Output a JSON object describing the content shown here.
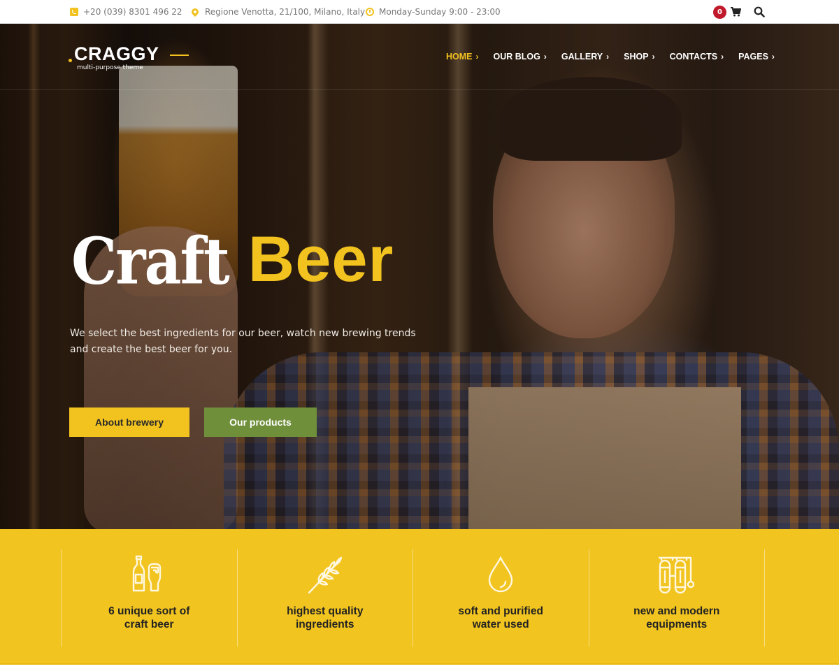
{
  "topbar": {
    "phone": "+20 (039) 8301 496 22",
    "address": "Regione Venotta, 21/100, Milano, Italy",
    "hours": "Monday-Sunday 9:00 - 23:00",
    "cart_count": "0",
    "icons": [
      "phone-icon",
      "map-pin-icon",
      "clock-icon",
      "cart-icon",
      "search-icon"
    ]
  },
  "header": {
    "logo_name": "CRAGGY",
    "logo_tagline": "multi-purpose theme",
    "nav": [
      {
        "label": "HOME",
        "active": true
      },
      {
        "label": "OUR BLOG",
        "active": false
      },
      {
        "label": "GALLERY",
        "active": false
      },
      {
        "label": "SHOP",
        "active": false
      },
      {
        "label": "CONTACTS",
        "active": false
      },
      {
        "label": "PAGES",
        "active": false
      }
    ],
    "chevron": "›"
  },
  "hero": {
    "title_part1": "Craft",
    "title_part2": "Beer",
    "description": "We select the best ingredients for our beer, watch new brewing trends and create the best beer for you.",
    "buttons": {
      "about": "About brewery",
      "products": "Our products"
    }
  },
  "features": [
    {
      "icon": "bottle-and-glass-icon",
      "label": "6 unique sort of craft beer"
    },
    {
      "icon": "wheat-icon",
      "label": "highest quality ingredients"
    },
    {
      "icon": "water-drop-icon",
      "label": "soft and purified water used"
    },
    {
      "icon": "brewing-tanks-icon",
      "label": "new and modern equipments"
    }
  ],
  "colors": {
    "accent_yellow": "#f2c21f",
    "accent_green": "#6f8f3b",
    "badge_red": "#c0192b"
  }
}
